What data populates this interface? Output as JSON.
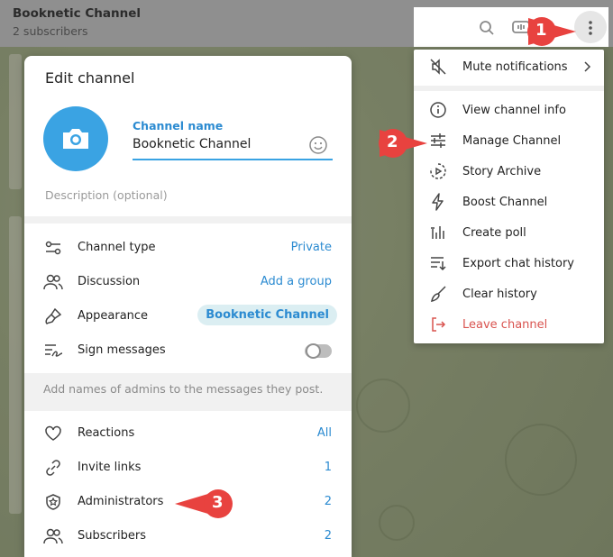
{
  "header": {
    "title": "Booknetic Channel",
    "subtitle": "2 subscribers",
    "icons": [
      "search-icon",
      "voice-chat-icon",
      "more-vert-icon"
    ]
  },
  "menu": {
    "items": [
      {
        "label": "Mute notifications",
        "icon": "mute-icon",
        "has_arrow": true
      },
      {
        "label": "View channel info",
        "icon": "info-icon"
      },
      {
        "label": "Manage Channel",
        "icon": "sliders-icon"
      },
      {
        "label": "Story Archive",
        "icon": "story-archive-icon"
      },
      {
        "label": "Boost Channel",
        "icon": "bolt-icon"
      },
      {
        "label": "Create poll",
        "icon": "poll-icon"
      },
      {
        "label": "Export chat history",
        "icon": "export-icon"
      },
      {
        "label": "Clear history",
        "icon": "broom-icon"
      },
      {
        "label": "Leave channel",
        "icon": "leave-icon",
        "danger": true
      }
    ]
  },
  "panel": {
    "title": "Edit channel",
    "channel_name_label": "Channel name",
    "channel_name_value": "Booknetic Channel",
    "description_placeholder": "Description (optional)",
    "settings": [
      {
        "label": "Channel type",
        "value": "Private",
        "icon": "channel-type-icon"
      },
      {
        "label": "Discussion",
        "value": "Add a group",
        "icon": "discussion-icon"
      },
      {
        "label": "Appearance",
        "value": "Booknetic Channel",
        "icon": "brush-icon"
      },
      {
        "label": "Sign messages",
        "icon": "signature-icon",
        "toggle_on": false
      }
    ],
    "sign_hint": "Add names of admins to the messages they post.",
    "stats": [
      {
        "label": "Reactions",
        "value": "All",
        "icon": "heart-icon"
      },
      {
        "label": "Invite links",
        "value": "1",
        "icon": "link-icon"
      },
      {
        "label": "Administrators",
        "value": "2",
        "icon": "admin-shield-icon"
      },
      {
        "label": "Subscribers",
        "value": "2",
        "icon": "subscribers-icon"
      }
    ]
  },
  "callouts": [
    "1",
    "2",
    "3"
  ],
  "colors": {
    "accent": "#3aa3e3",
    "link": "#2c8bd1",
    "danger": "#d9534f",
    "callout": "#e8423f"
  }
}
